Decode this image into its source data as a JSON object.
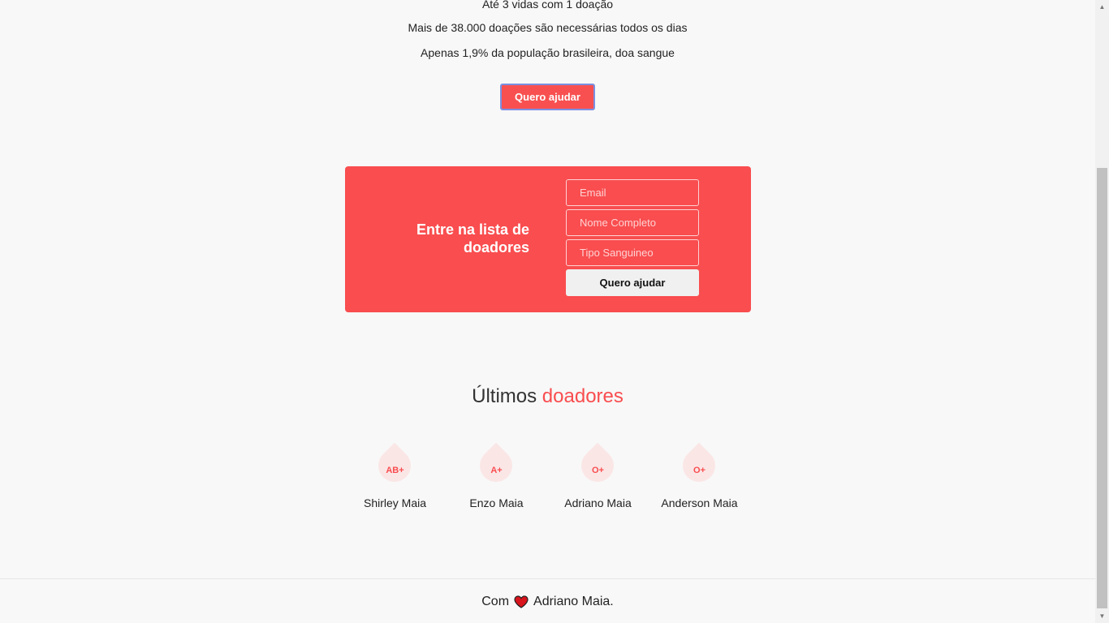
{
  "facts": [
    "Até 3 vidas com 1 doação",
    "Mais de 38.000 doações são necessárias todos os dias",
    "Apenas 1,9% da população brasileira, doa sangue"
  ],
  "hero": {
    "button_label": "Quero ajudar"
  },
  "signup": {
    "title_line1": "Entre na lista de",
    "title_line2": "doadores",
    "email_placeholder": "Email",
    "name_placeholder": "Nome Completo",
    "blood_placeholder": "Tipo Sanguineo",
    "submit_label": "Quero ajudar",
    "background_color": "#f94d4f"
  },
  "donors_section": {
    "title_plain": "Últimos",
    "title_accent": "doadores",
    "donors": [
      {
        "blood_type": "AB+",
        "name": "Shirley Maia"
      },
      {
        "blood_type": "A+",
        "name": "Enzo Maia"
      },
      {
        "blood_type": "O+",
        "name": "Adriano Maia"
      },
      {
        "blood_type": "O+",
        "name": "Anderson Maia"
      }
    ]
  },
  "footer": {
    "prefix": "Com",
    "icon": "heart-icon",
    "author": "Adriano Maia."
  },
  "colors": {
    "accent": "#f94d4f",
    "background": "#f8f8f8"
  }
}
